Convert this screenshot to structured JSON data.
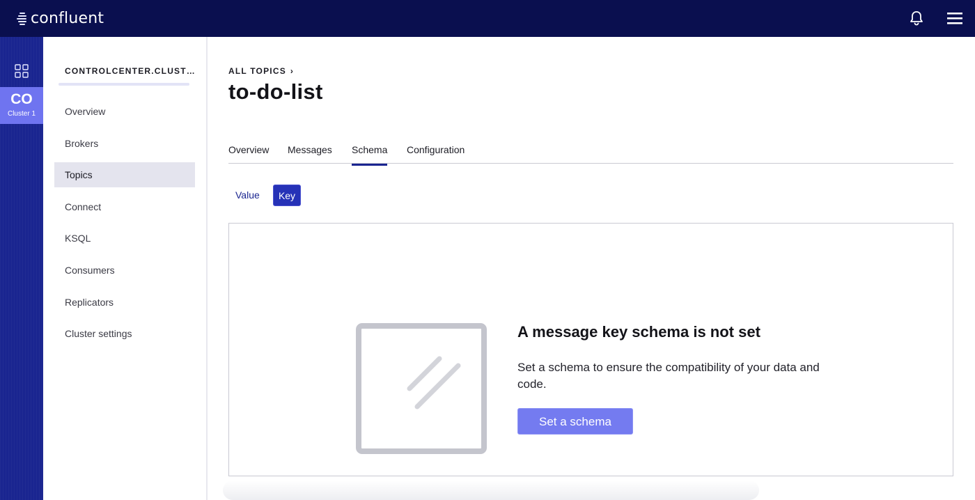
{
  "brand": {
    "name": "confluent",
    "colors": {
      "navy": "#0a0f4f",
      "rail": "#1a2590",
      "accent": "#747bf0",
      "tile": "#6f74f0"
    }
  },
  "topbar": {
    "notifications_icon": "bell-icon",
    "menu_icon": "hamburger-menu-icon"
  },
  "rail": {
    "apps_icon": "grid-icon",
    "cluster": {
      "abbr": "CO",
      "name": "Cluster 1"
    }
  },
  "sidebar": {
    "cluster_title": "CONTROLCENTER.CLUST…",
    "items": [
      {
        "label": "Overview"
      },
      {
        "label": "Brokers"
      },
      {
        "label": "Topics",
        "active": true
      },
      {
        "label": "Connect"
      },
      {
        "label": "KSQL"
      },
      {
        "label": "Consumers"
      },
      {
        "label": "Replicators"
      },
      {
        "label": "Cluster settings"
      }
    ]
  },
  "main": {
    "breadcrumb": "ALL TOPICS",
    "title": "to-do-list",
    "tabs": [
      {
        "label": "Overview"
      },
      {
        "label": "Messages"
      },
      {
        "label": "Schema",
        "active": true
      },
      {
        "label": "Configuration"
      }
    ],
    "schema_toggle": {
      "value_label": "Value",
      "key_label": "Key",
      "selected": "Key"
    },
    "empty_state": {
      "heading": "A message key schema is not set",
      "description": "Set a schema to ensure the compatibility of your data and code.",
      "button_label": "Set a schema",
      "illustration_icon": "empty-document-icon"
    }
  }
}
